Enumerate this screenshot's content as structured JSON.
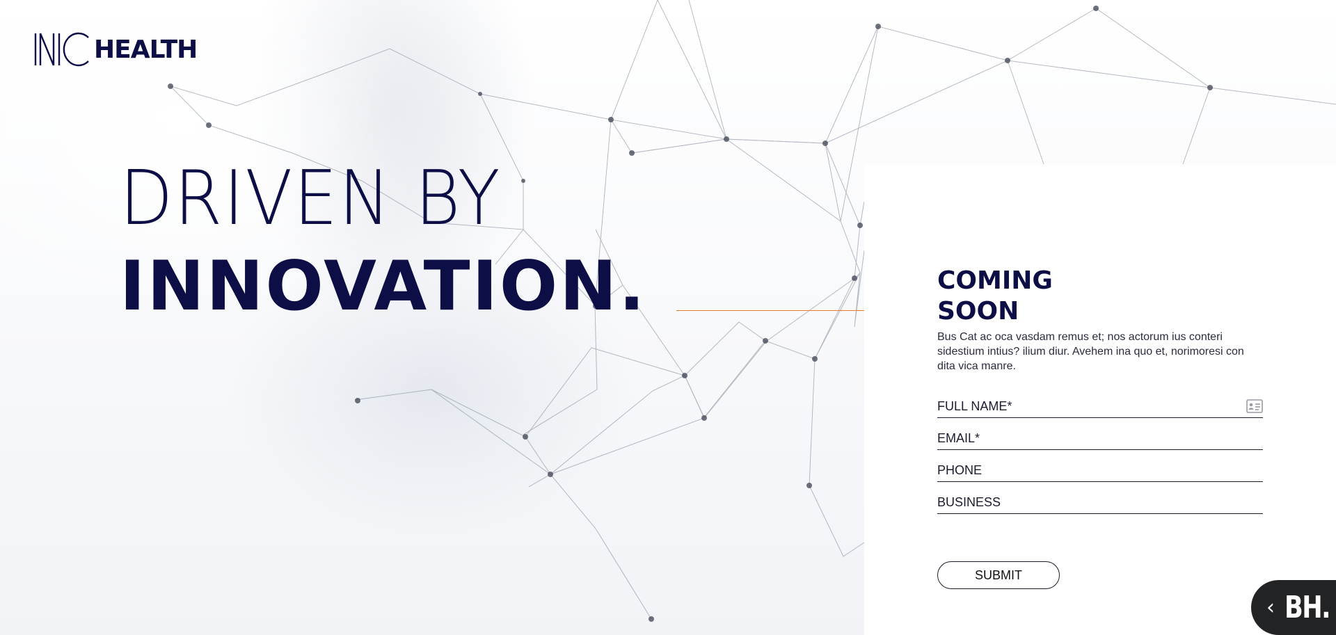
{
  "brand": {
    "name": "HEALTH",
    "colors": {
      "navy": "#0c0e45",
      "accent": "#ef7d24",
      "panel": "#ffffff"
    }
  },
  "hero": {
    "line1": "DRIVEN BY",
    "line2": "INNOVATION."
  },
  "signup": {
    "heading_line1": "COMING",
    "heading_line2": "SOON",
    "description": "Bus Cat ac oca vasdam remus et; nos actorum ius conteri sidestium intius? ilium diur. Avehem ina quo et, norimoresi con dita vica manre.",
    "fields": [
      {
        "placeholder": "FULL NAME*",
        "icon": "contact-card-icon"
      },
      {
        "placeholder": "EMAIL*"
      },
      {
        "placeholder": "PHONE"
      },
      {
        "placeholder": "BUSINESS"
      }
    ],
    "submit_label": "SUBMIT"
  },
  "badge": {
    "chevron": "‹",
    "label": "BH."
  }
}
